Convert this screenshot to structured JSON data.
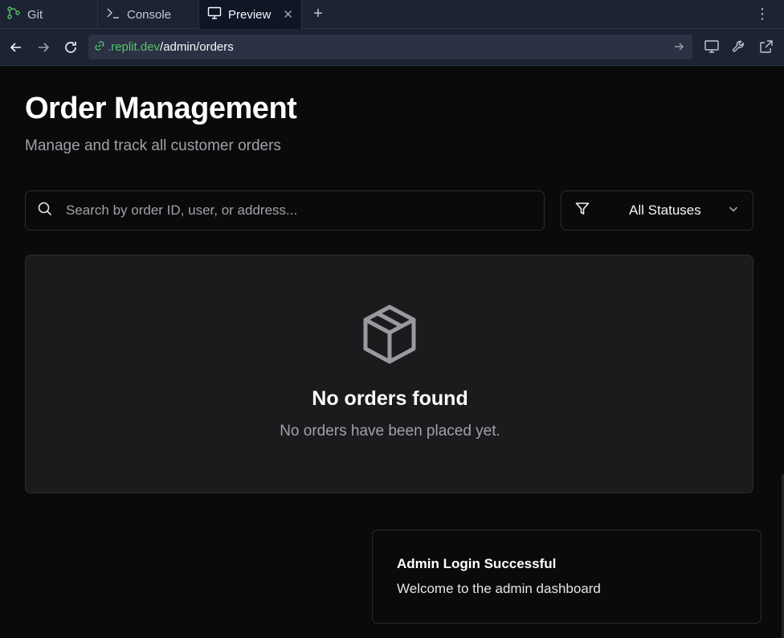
{
  "tabs": {
    "git": "Git",
    "console": "Console",
    "preview": "Preview",
    "new_tab": "+"
  },
  "address": {
    "host": ".replit.dev",
    "path": "/admin/orders"
  },
  "page": {
    "title": "Order Management",
    "subtitle": "Manage and track all customer orders",
    "search_placeholder": "Search by order ID, user, or address...",
    "status_filter": "All Statuses",
    "empty_title": "No orders found",
    "empty_desc": "No orders have been placed yet."
  },
  "toast": {
    "title": "Admin Login Successful",
    "desc": "Welcome to the admin dashboard"
  },
  "colors": {
    "accent_green": "#56c26b",
    "background": "#0a0a0a",
    "card": "#1b1b1d"
  }
}
